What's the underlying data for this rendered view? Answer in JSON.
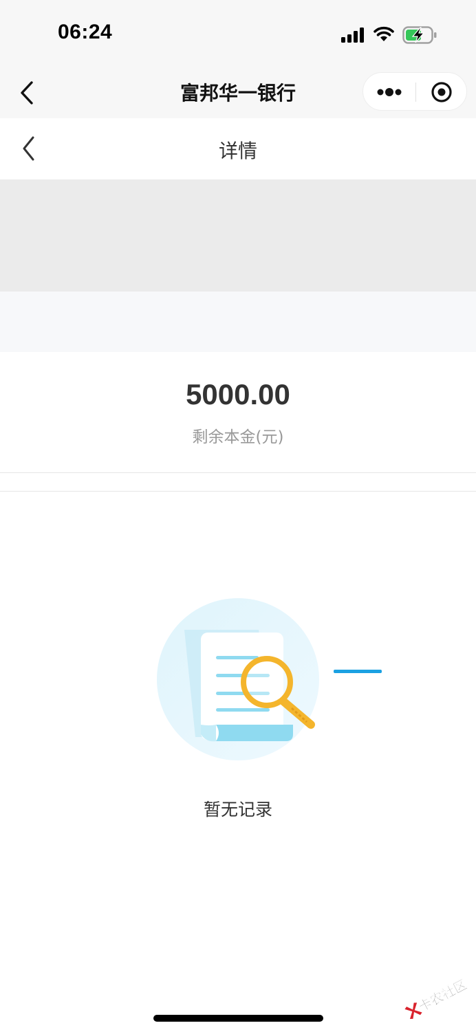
{
  "status_bar": {
    "time": "06:24",
    "icons": [
      "signal-icon",
      "wifi-icon",
      "battery-charging-icon"
    ]
  },
  "nav_bar": {
    "title": "富邦华一银行",
    "back_icon": "chevron-left-icon",
    "capsule": {
      "more_icon": "more-dots-icon",
      "close_icon": "target-close-icon"
    }
  },
  "page_header": {
    "title": "详情",
    "back_icon": "chevron-left-icon"
  },
  "summary": {
    "amount": "5000.00",
    "amount_label": "剩余本金(元)"
  },
  "empty_state": {
    "icon": "document-search-icon",
    "message": "暂无记录"
  },
  "watermark": {
    "text": "卡农社区"
  },
  "colors": {
    "accent_blue": "#1ba1e2",
    "illustration_circle": "#e6f7fd",
    "magnifier": "#f4b52c"
  }
}
